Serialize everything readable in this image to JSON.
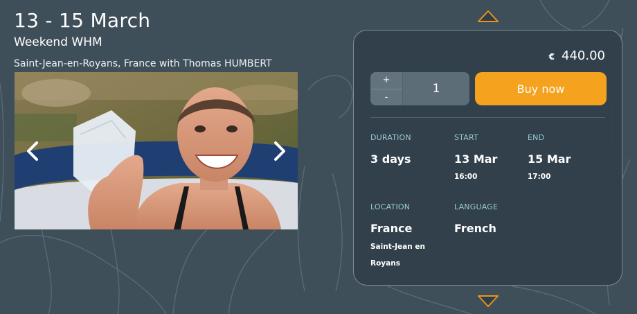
{
  "event": {
    "date_range": "13 - 15 March",
    "title": "Weekend WHM",
    "subtitle": "Saint-Jean-en-Royans, France with Thomas HUMBERT"
  },
  "gallery": {
    "prev_icon": "chevron-left-icon",
    "next_icon": "chevron-right-icon"
  },
  "navigation": {
    "up_icon": "triangle-up-icon",
    "down_icon": "triangle-down-icon"
  },
  "booking": {
    "currency": "€",
    "price": "440.00",
    "quantity": {
      "plus_label": "+",
      "minus_label": "-",
      "value": "1"
    },
    "buy_label": "Buy now",
    "details": {
      "duration": {
        "label": "DURATION",
        "value": "3 days"
      },
      "start": {
        "label": "START",
        "value": "13 Mar",
        "time": "16:00"
      },
      "end": {
        "label": "END",
        "value": "15 Mar",
        "time": "17:00"
      },
      "location": {
        "label": "LOCATION",
        "value": "France",
        "sub": "Saint-Jean en Royans"
      },
      "language": {
        "label": "LANGUAGE",
        "value": "French"
      }
    }
  },
  "colors": {
    "background": "#3f4f5a",
    "panel": "#303e49",
    "accent": "#f5a21f",
    "label": "#9ccbd4"
  }
}
